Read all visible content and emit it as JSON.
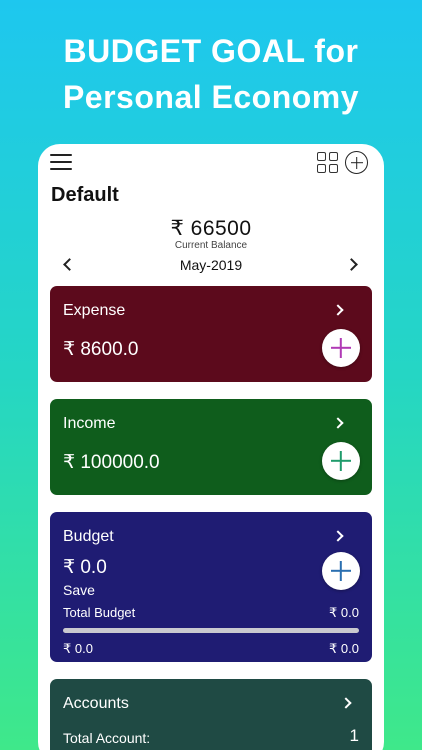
{
  "promo": {
    "line1": "BUDGET GOAL for",
    "line2": "Personal Economy"
  },
  "header": {
    "title": "Default",
    "menu_icon": "hamburger-menu-icon",
    "grid_icon": "grid-view-icon",
    "add_icon": "add-circle-icon"
  },
  "balance": {
    "amount": "₹ 66500",
    "label": "Current Balance"
  },
  "period": {
    "month": "May-2019"
  },
  "cards": {
    "expense": {
      "title": "Expense",
      "amount": "₹ 8600.0",
      "color": "#5c0a1c",
      "plus_color": "#b03ab5"
    },
    "income": {
      "title": "Income",
      "amount": "₹ 100000.0",
      "color": "#0f5d1c",
      "plus_color": "#1f9b6b"
    },
    "budget": {
      "title": "Budget",
      "amount": "₹ 0.0",
      "save_label": "Save",
      "total_label": "Total Budget",
      "total_value": "₹ 0.0",
      "progress_fraction": 0,
      "spent_left": "₹ 0.0",
      "spent_right": "₹ 0.0",
      "color": "#1f1c73",
      "plus_color": "#2a6fb0"
    },
    "accounts": {
      "title": "Accounts",
      "total_label": "Total Account:",
      "total_value": "1",
      "color": "#1f4a44"
    }
  },
  "theme": {
    "gradient_top": "#1ec7ef",
    "gradient_bottom": "#3fe88a"
  }
}
